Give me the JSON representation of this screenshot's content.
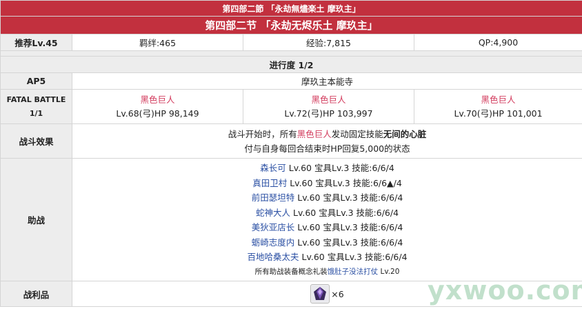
{
  "title_jp": "第四部二節 「永劫無燼楽土 摩玖主」",
  "title_cn": "第四部二节 「永劫无烬乐土 摩玖主」",
  "info_row": {
    "recommend": "推荐Lv.45",
    "bond": "羁绊:465",
    "exp": "经验:7,815",
    "qp": "QP:4,900"
  },
  "progress": "进行度 1/2",
  "ap": {
    "label": "AP5",
    "location": "摩玖主本能寺"
  },
  "battle": {
    "label_line1": "FATAL BATTLE",
    "label_line2": "1/1",
    "enemies": [
      {
        "name": "黑色巨人",
        "stats": "Lv.68(弓)HP 98,149"
      },
      {
        "name": "黑色巨人",
        "stats": "Lv.72(弓)HP 103,997"
      },
      {
        "name": "黑色巨人",
        "stats": "Lv.70(弓)HP 101,001"
      }
    ]
  },
  "effects": {
    "label": "战斗效果",
    "line1_a": "战斗开始时，所有",
    "line1_enemy": "黑色巨人",
    "line1_b": "发动固定技能",
    "line1_skill": "无间的心脏",
    "line2": "付与自身每回合结束时HP回复5,000的状态"
  },
  "support": {
    "label": "助战",
    "servants": [
      {
        "name": "森长可",
        "detail": " Lv.60 宝具Lv.3 技能:6/6/4"
      },
      {
        "name": "真田卫村",
        "detail": " Lv.60 宝具Lv.3 技能:6/6▲/4"
      },
      {
        "name": "前田瑟坦特",
        "detail": " Lv.60 宝具Lv.3 技能:6/6/4"
      },
      {
        "name": "蛇神大人",
        "detail": " Lv.60 宝具Lv.3 技能:6/6/4"
      },
      {
        "name": "美狄亚店长",
        "detail": " Lv.60 宝具Lv.3 技能:6/6/4"
      },
      {
        "name": "蛎崎志度内",
        "detail": " Lv.60 宝具Lv.3 技能:6/6/4"
      },
      {
        "name": "百地哈桑太夫",
        "detail": " Lv.60 宝具Lv.3 技能:6/6/4"
      }
    ],
    "ce_note_a": "所有助战装备概念礼装",
    "ce_name": "饿肚子没法打仗",
    "ce_note_b": " Lv.20"
  },
  "loot": {
    "label": "战利品",
    "item_icon": "purple-crystal-icon",
    "count": "×6"
  },
  "watermark": "yxwoo.com",
  "colors": {
    "banner": "#c2303e",
    "header_bg": "#ededed",
    "enemy": "#d23a5c",
    "servant_link": "#2a4fa3"
  }
}
